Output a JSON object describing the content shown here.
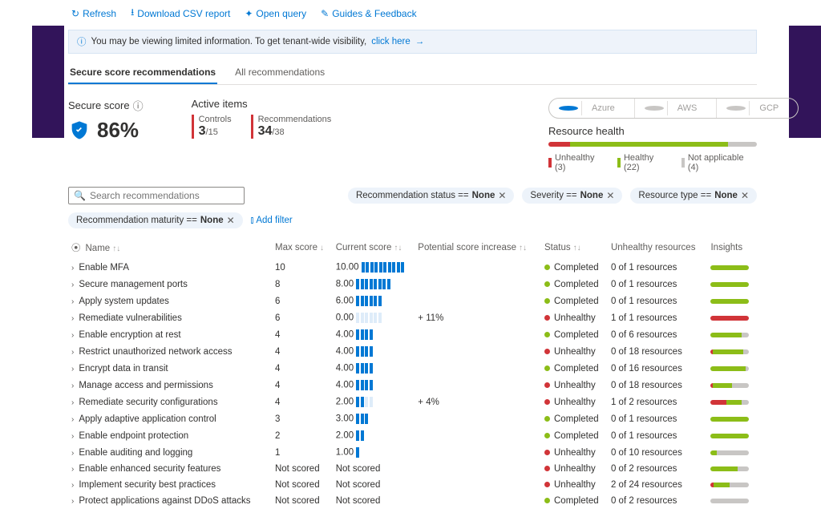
{
  "toolbar": {
    "refresh": "Refresh",
    "download": "Download CSV report",
    "open_query": "Open query",
    "guides": "Guides & Feedback"
  },
  "info_banner": {
    "text": "You may be viewing limited information. To get tenant-wide visibility,",
    "link": "click here"
  },
  "tabs": {
    "secure": "Secure score recommendations",
    "all": "All recommendations"
  },
  "score": {
    "label": "Secure score",
    "value": "86%"
  },
  "active": {
    "label": "Active items",
    "controls_label": "Controls",
    "controls_num": "3",
    "controls_den": "/15",
    "recs_label": "Recommendations",
    "recs_num": "34",
    "recs_den": "/38"
  },
  "clouds": {
    "azure": "Azure",
    "aws": "AWS",
    "gcp": "GCP"
  },
  "health": {
    "label": "Resource health",
    "unhealthy": "Unhealthy (3)",
    "healthy": "Healthy (22)",
    "na": "Not applicable (4)"
  },
  "search_placeholder": "Search recommendations",
  "filters": {
    "status": "Recommendation status == ",
    "severity": "Severity == ",
    "type": "Resource type == ",
    "maturity": "Recommendation maturity == ",
    "none": "None",
    "add": "Add filter"
  },
  "columns": {
    "name": "Name",
    "max": "Max score",
    "current": "Current score",
    "potential": "Potential score increase",
    "status": "Status",
    "unhealthy": "Unhealthy resources",
    "insights": "Insights"
  },
  "rows": [
    {
      "name": "Enable MFA",
      "max": "10",
      "cval": "10.00",
      "filled": 10,
      "total": 10,
      "pot": "",
      "status": "Completed",
      "sc": "g",
      "res": "0 of 1 resources",
      "bar": [
        0,
        100,
        0
      ]
    },
    {
      "name": "Secure management ports",
      "max": "8",
      "cval": "8.00",
      "filled": 8,
      "total": 8,
      "pot": "",
      "status": "Completed",
      "sc": "g",
      "res": "0 of 1 resources",
      "bar": [
        0,
        100,
        0
      ]
    },
    {
      "name": "Apply system updates",
      "max": "6",
      "cval": "6.00",
      "filled": 6,
      "total": 6,
      "pot": "",
      "status": "Completed",
      "sc": "g",
      "res": "0 of 1 resources",
      "bar": [
        0,
        100,
        0
      ]
    },
    {
      "name": "Remediate vulnerabilities",
      "max": "6",
      "cval": "0.00",
      "filled": 0,
      "total": 6,
      "pot": "+ 11%",
      "status": "Unhealthy",
      "sc": "r",
      "res": "1 of 1 resources",
      "bar": [
        100,
        0,
        0
      ]
    },
    {
      "name": "Enable encryption at rest",
      "max": "4",
      "cval": "4.00",
      "filled": 4,
      "total": 4,
      "pot": "",
      "status": "Completed",
      "sc": "g",
      "res": "0 of 6 resources",
      "bar": [
        0,
        80,
        20
      ]
    },
    {
      "name": "Restrict unauthorized network access",
      "max": "4",
      "cval": "4.00",
      "filled": 4,
      "total": 4,
      "pot": "",
      "status": "Unhealthy",
      "sc": "r",
      "res": "0 of 18 resources",
      "bar": [
        5,
        80,
        15
      ]
    },
    {
      "name": "Encrypt data in transit",
      "max": "4",
      "cval": "4.00",
      "filled": 4,
      "total": 4,
      "pot": "",
      "status": "Completed",
      "sc": "g",
      "res": "0 of 16 resources",
      "bar": [
        0,
        90,
        10
      ]
    },
    {
      "name": "Manage access and permissions",
      "max": "4",
      "cval": "4.00",
      "filled": 4,
      "total": 4,
      "pot": "",
      "status": "Unhealthy",
      "sc": "r",
      "res": "0 of 18 resources",
      "bar": [
        5,
        50,
        45
      ]
    },
    {
      "name": "Remediate security configurations",
      "max": "4",
      "cval": "2.00",
      "filled": 2,
      "total": 4,
      "pot": "+ 4%",
      "status": "Unhealthy",
      "sc": "r",
      "res": "1 of 2 resources",
      "bar": [
        40,
        40,
        20
      ]
    },
    {
      "name": "Apply adaptive application control",
      "max": "3",
      "cval": "3.00",
      "filled": 3,
      "total": 3,
      "pot": "",
      "status": "Completed",
      "sc": "g",
      "res": "0 of 1 resources",
      "bar": [
        0,
        100,
        0
      ]
    },
    {
      "name": "Enable endpoint protection",
      "max": "2",
      "cval": "2.00",
      "filled": 2,
      "total": 2,
      "pot": "",
      "status": "Completed",
      "sc": "g",
      "res": "0 of 1 resources",
      "bar": [
        0,
        100,
        0
      ]
    },
    {
      "name": "Enable auditing and logging",
      "max": "1",
      "cval": "1.00",
      "filled": 1,
      "total": 1,
      "pot": "",
      "status": "Unhealthy",
      "sc": "r",
      "res": "0 of 10 resources",
      "bar": [
        0,
        15,
        85
      ]
    },
    {
      "name": "Enable enhanced security features",
      "max": "Not scored",
      "cval": "Not scored",
      "filled": 0,
      "total": 0,
      "pot": "",
      "status": "Unhealthy",
      "sc": "r",
      "res": "0 of 2 resources",
      "bar": [
        0,
        70,
        30
      ]
    },
    {
      "name": "Implement security best practices",
      "max": "Not scored",
      "cval": "Not scored",
      "filled": 0,
      "total": 0,
      "pot": "",
      "status": "Unhealthy",
      "sc": "r",
      "res": "2 of 24 resources",
      "bar": [
        8,
        42,
        50
      ]
    },
    {
      "name": "Protect applications against DDoS attacks",
      "max": "Not scored",
      "cval": "Not scored",
      "filled": 0,
      "total": 0,
      "pot": "",
      "status": "Completed",
      "sc": "g",
      "res": "0 of 2 resources",
      "bar": [
        0,
        0,
        100
      ]
    }
  ]
}
